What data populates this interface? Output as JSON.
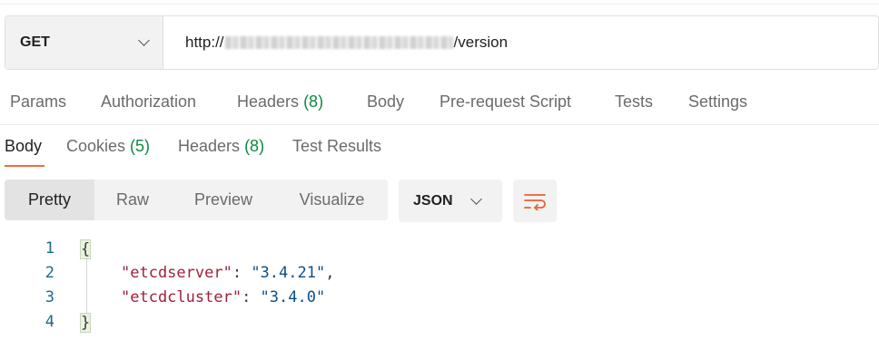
{
  "request": {
    "method": "GET",
    "url_prefix": "http://",
    "url_suffix": "/version"
  },
  "request_tabs": [
    {
      "label": "Params"
    },
    {
      "label": "Authorization"
    },
    {
      "label": "Headers",
      "count": "(8)"
    },
    {
      "label": "Body"
    },
    {
      "label": "Pre-request Script"
    },
    {
      "label": "Tests"
    },
    {
      "label": "Settings"
    }
  ],
  "response_tabs": [
    {
      "label": "Body",
      "active": true
    },
    {
      "label": "Cookies",
      "count": "(5)"
    },
    {
      "label": "Headers",
      "count": "(8)"
    },
    {
      "label": "Test Results"
    }
  ],
  "view_modes": [
    "Pretty",
    "Raw",
    "Preview",
    "Visualize"
  ],
  "active_view_mode": "Pretty",
  "format": "JSON",
  "code": {
    "line_numbers": [
      "1",
      "2",
      "3",
      "4"
    ],
    "open_brace": "{",
    "close_brace": "}",
    "entries": [
      {
        "key": "\"etcdserver\"",
        "colon": ": ",
        "value": "\"3.4.21\"",
        "comma": ","
      },
      {
        "key": "\"etcdcluster\"",
        "colon": ": ",
        "value": "\"3.4.0\"",
        "comma": ""
      }
    ]
  },
  "colors": {
    "accent": "#f26b3a",
    "count": "#0d8a3e",
    "json_key": "#a0213a",
    "json_string": "#0c4f8a",
    "line_number": "#1c6a8a"
  },
  "icons": {
    "method_dropdown": "chevron-down-icon",
    "format_dropdown": "chevron-down-icon",
    "wrap": "wrap-lines-icon"
  }
}
